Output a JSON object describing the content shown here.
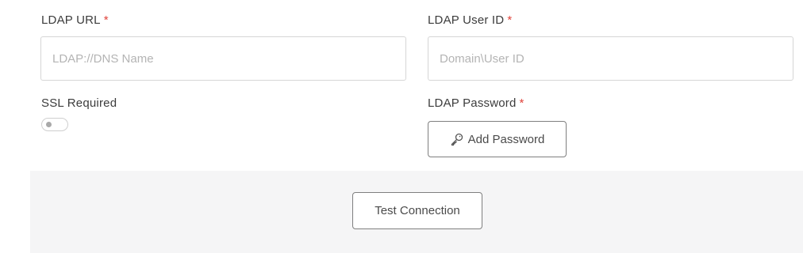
{
  "ldap_url": {
    "label": "LDAP URL",
    "required_mark": "*",
    "placeholder": "LDAP://DNS Name",
    "value": ""
  },
  "ldap_user_id": {
    "label": "LDAP User ID",
    "required_mark": "*",
    "placeholder": "Domain\\User ID",
    "value": ""
  },
  "ssl_required": {
    "label": "SSL Required",
    "enabled": false
  },
  "ldap_password": {
    "label": "LDAP Password",
    "required_mark": "*",
    "button_label": "Add Password",
    "button_icon": "key-icon"
  },
  "footer": {
    "test_connection_label": "Test Connection"
  },
  "colors": {
    "required": "#e0433b",
    "footer_background": "#f5f5f6",
    "border": "#d6d6d6",
    "button_border": "#7f7f7f"
  }
}
